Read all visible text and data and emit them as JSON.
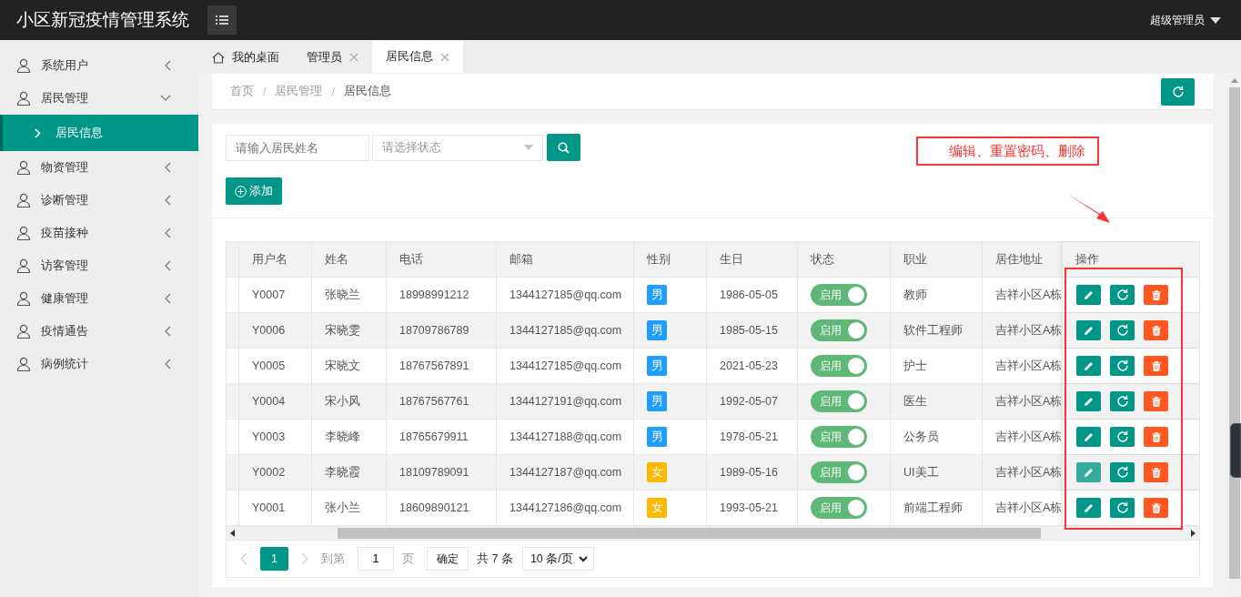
{
  "app_title": "小区新冠疫情管理系统",
  "user_menu": "超级管理员",
  "sidebar": {
    "items": [
      {
        "label": "系统用户",
        "expanded": false
      },
      {
        "label": "居民管理",
        "expanded": true,
        "children": [
          {
            "label": "居民信息",
            "selected": true
          }
        ]
      },
      {
        "label": "物资管理",
        "expanded": false
      },
      {
        "label": "诊断管理",
        "expanded": false
      },
      {
        "label": "疫苗接种",
        "expanded": false
      },
      {
        "label": "访客管理",
        "expanded": false
      },
      {
        "label": "健康管理",
        "expanded": false
      },
      {
        "label": "疫情通告",
        "expanded": false
      },
      {
        "label": "病例统计",
        "expanded": false
      }
    ]
  },
  "tabs": [
    {
      "label": "我的桌面",
      "kind": "home",
      "selected": false
    },
    {
      "label": "管理员",
      "kind": "closable",
      "selected": false
    },
    {
      "label": "居民信息",
      "kind": "closable",
      "selected": true
    }
  ],
  "breadcrumb": {
    "separator": "/",
    "items": [
      "首页",
      "居民管理",
      "居民信息"
    ]
  },
  "search": {
    "placeholder": "请输入居民姓名"
  },
  "status_select": {
    "placeholder": "请选择状态"
  },
  "add_button": "添加",
  "annotation": "编辑、重置密码、删除",
  "table": {
    "columns": [
      "用户名",
      "姓名",
      "电话",
      "邮箱",
      "性别",
      "生日",
      "状态",
      "职业",
      "居住地址",
      "操作"
    ],
    "rows": [
      {
        "username": "Y0007",
        "name": "张晓兰",
        "phone": "18998991212",
        "email": "1344127185@qq.com",
        "gender": {
          "label": "男",
          "kind": "male"
        },
        "birthday": "1986-05-05",
        "status": {
          "label": "启用",
          "on": true
        },
        "job": "教师",
        "address": "吉祥小区A栋",
        "edit_hovered": false
      },
      {
        "username": "Y0006",
        "name": "宋晓雯",
        "phone": "18709786789",
        "email": "1344127185@qq.com",
        "gender": {
          "label": "男",
          "kind": "male"
        },
        "birthday": "1985-05-15",
        "status": {
          "label": "启用",
          "on": true
        },
        "job": "软件工程师",
        "address": "吉祥小区A栋",
        "edit_hovered": false
      },
      {
        "username": "Y0005",
        "name": "宋晓文",
        "phone": "18767567891",
        "email": "1344127185@qq.com",
        "gender": {
          "label": "男",
          "kind": "male"
        },
        "birthday": "2021-05-23",
        "status": {
          "label": "启用",
          "on": true
        },
        "job": "护士",
        "address": "吉祥小区A栋",
        "edit_hovered": false
      },
      {
        "username": "Y0004",
        "name": "宋小风",
        "phone": "18767567761",
        "email": "1344127191@qq.com",
        "gender": {
          "label": "男",
          "kind": "male"
        },
        "birthday": "1992-05-07",
        "status": {
          "label": "启用",
          "on": true
        },
        "job": "医生",
        "address": "吉祥小区A栋",
        "edit_hovered": false
      },
      {
        "username": "Y0003",
        "name": "李晓峰",
        "phone": "18765679911",
        "email": "1344127188@qq.com",
        "gender": {
          "label": "男",
          "kind": "male"
        },
        "birthday": "1978-05-21",
        "status": {
          "label": "启用",
          "on": true
        },
        "job": "公务员",
        "address": "吉祥小区A栋",
        "edit_hovered": false
      },
      {
        "username": "Y0002",
        "name": "李晓霞",
        "phone": "18109789091",
        "email": "1344127187@qq.com",
        "gender": {
          "label": "女",
          "kind": "female"
        },
        "birthday": "1989-05-16",
        "status": {
          "label": "启用",
          "on": true
        },
        "job": "UI美工",
        "address": "吉祥小区A栋",
        "edit_hovered": true
      },
      {
        "username": "Y0001",
        "name": "张小兰",
        "phone": "18609890121",
        "email": "1344127186@qq.com",
        "gender": {
          "label": "女",
          "kind": "female"
        },
        "birthday": "1993-05-21",
        "status": {
          "label": "启用",
          "on": true
        },
        "job": "前端工程师",
        "address": "吉祥小区A栋",
        "edit_hovered": false
      }
    ]
  },
  "pagination": {
    "current": "1",
    "goto_label": "到第",
    "goto_value": "1",
    "page_label": "页",
    "confirm": "确定",
    "total": "共 7 条",
    "page_size": "10 条/页"
  }
}
